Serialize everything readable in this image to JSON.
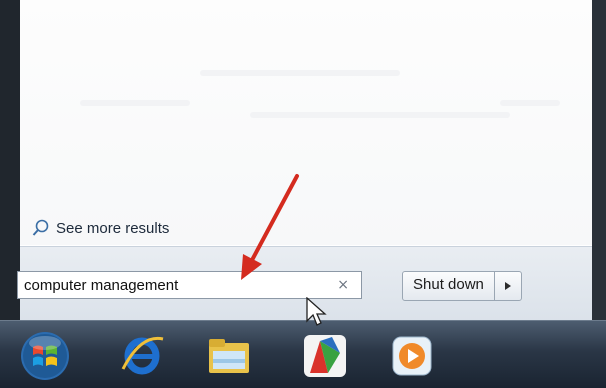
{
  "start_menu": {
    "see_more_label": "See more results",
    "search": {
      "value": "computer management",
      "placeholder": ""
    },
    "clear_symbol": "×",
    "shutdown_label": "Shut down",
    "shutdown_arrow_symbol": "▸"
  },
  "icons": {
    "see_more": "search-icon",
    "start": "windows-start-orb-icon",
    "browser": "internet-explorer-icon",
    "explorer": "windows-explorer-icon",
    "app4": "colorful-app-icon",
    "media": "media-player-icon"
  },
  "colors": {
    "annotation_arrow": "#d42b1f",
    "taskbar": "#2a3646"
  }
}
